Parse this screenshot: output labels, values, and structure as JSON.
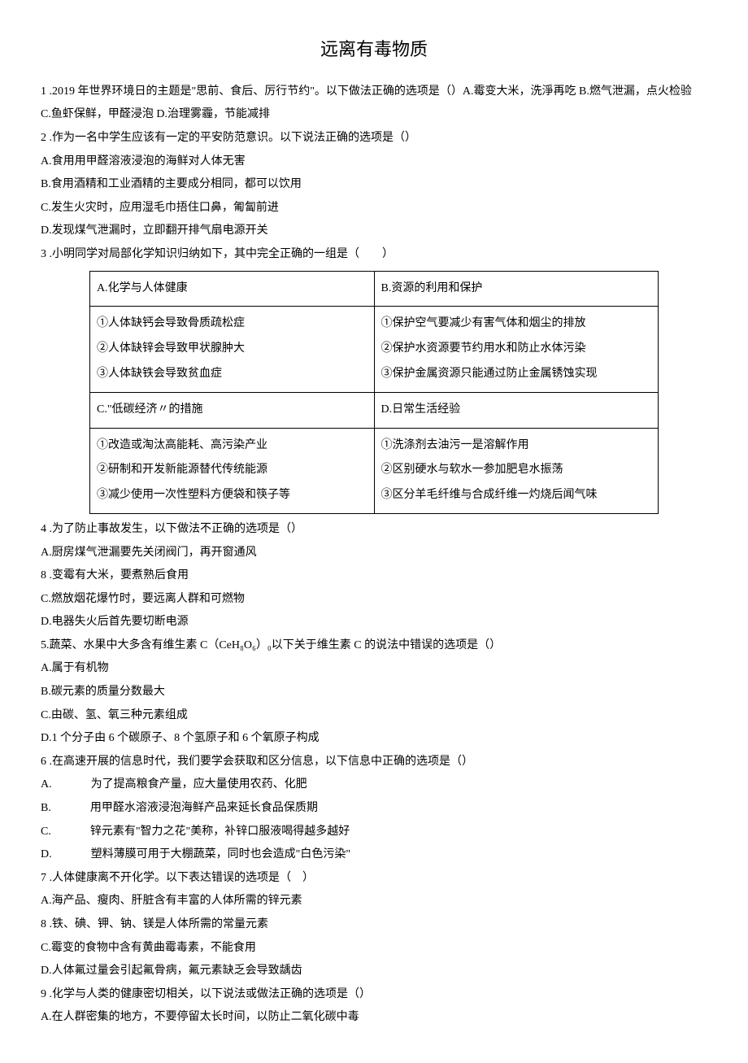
{
  "title": "远离有毒物质",
  "q1": {
    "stem": "1 .2019 年世界环境日的主题是\"思前、食后、厉行节约\"。以下做法正确的选项是（）A.霉变大米，洗淨再吃 B.燃气泄漏，点火检验",
    "optC": "C.鱼虾保鲜，甲醛浸泡 D.治理雾霾，节能减排"
  },
  "q2": {
    "stem": "2 .作为一名中学生应该有一定的平安防范意识。以下说法正确的选项是（）",
    "A": "A.食用用甲醛溶液浸泡的海鲜对人体无害",
    "B": "B.食用酒精和工业酒精的主要成分相同，都可以饮用",
    "C": "C.发生火灾时，应用湿毛巾捂住口鼻，匍匐前进",
    "D": "D.发现煤气泄漏时，立即翻开排气扇电源开关"
  },
  "q3": {
    "stem": "3 .小明同学对局部化学知识归纳如下，其中完全正确的一组是（　　）",
    "table": {
      "r1c1h": "A.化学与人体健康",
      "r1c2h": "B.资源的利用和保护",
      "r2c1_1": "①人体缺钙会导致骨质疏松症",
      "r2c1_2": "②人体缺锌会导致甲状腺肿大",
      "r2c1_3": "③人体缺铁会导致贫血症",
      "r2c2_1": "①保护空气要减少有害气体和烟尘的排放",
      "r2c2_2": "②保护水资源要节约用水和防止水体污染",
      "r2c2_3": "③保护金属资源只能通过防止金属锈蚀实现",
      "r3c1h": "C.\"低碳经济〃的措施",
      "r3c2h": "D.日常生活经验",
      "r4c1_1": "①改造或淘汰高能耗、高污染产业",
      "r4c1_2": "②研制和开发新能源替代传统能源",
      "r4c1_3": "③减少使用一次性塑料方便袋和筷子等",
      "r4c2_1": "①洗涤剂去油污一是溶解作用",
      "r4c2_2": "②区别硬水与软水一参加肥皂水振荡",
      "r4c2_3": "③区分羊毛纤维与合成纤维一灼烧后闻气味"
    }
  },
  "q4": {
    "stem": "4 .为了防止事故发生，以下做法不正确的选项是（）",
    "A": "A.厨房煤气泄漏要先关闭阀门，再开窗通风",
    "B": "8 .变霉有大米，要煮熟后食用",
    "C": "C.燃放烟花爆竹时，要远离人群和可燃物",
    "D": "D.电器失火后首先要切断电源"
  },
  "q5": {
    "stem": "5.蔬菜、水果中大多含有维生素 C（CeH₈O₆）₀以下关于维生素 C 的说法中错误的选项是（）",
    "A": "A.属于有机物",
    "B": "B.碳元素的质量分数最大",
    "C": "C.由碳、氢、氧三种元素组成",
    "D": "D.1 个分子由 6 个碳原子、8 个氢原子和 6 个氧原子构成"
  },
  "q6": {
    "stem": "6 .在高速开展的信息时代，我们要学会获取和区分信息，以下信息中正确的选项是（）",
    "A": "为了提高粮食产量，应大量使用农药、化肥",
    "B": "用甲醛水溶液浸泡海鲜产品来延长食品保质期",
    "C": "锌元素有\"智力之花\"美称，补锌口服液喝得越多越好",
    "D": "塑料薄膜可用于大棚蔬菜，同时也会造成\"白色污染\""
  },
  "q7": {
    "stem": "7 .人体健康离不开化学。以下表达错误的选项是（　）",
    "A": "A.海产品、瘦肉、肝脏含有丰富的人体所需的锌元素",
    "B": "8 .铁、碘、钾、钠、镁是人体所需的常量元素",
    "C": "C.霉变的食物中含有黄曲霉毒素，不能食用",
    "D": "D.人体氟过量会引起氟骨病，氟元素缺乏会导致龋齿"
  },
  "q9": {
    "stem": "9 .化学与人类的健康密切相关，以下说法或做法正确的选项是（）",
    "A": "A.在人群密集的地方，不要停留太长时间，以防止二氧化碳中毒"
  },
  "labels": {
    "A": "A.",
    "B": "B.",
    "C": "C.",
    "D": "D."
  }
}
